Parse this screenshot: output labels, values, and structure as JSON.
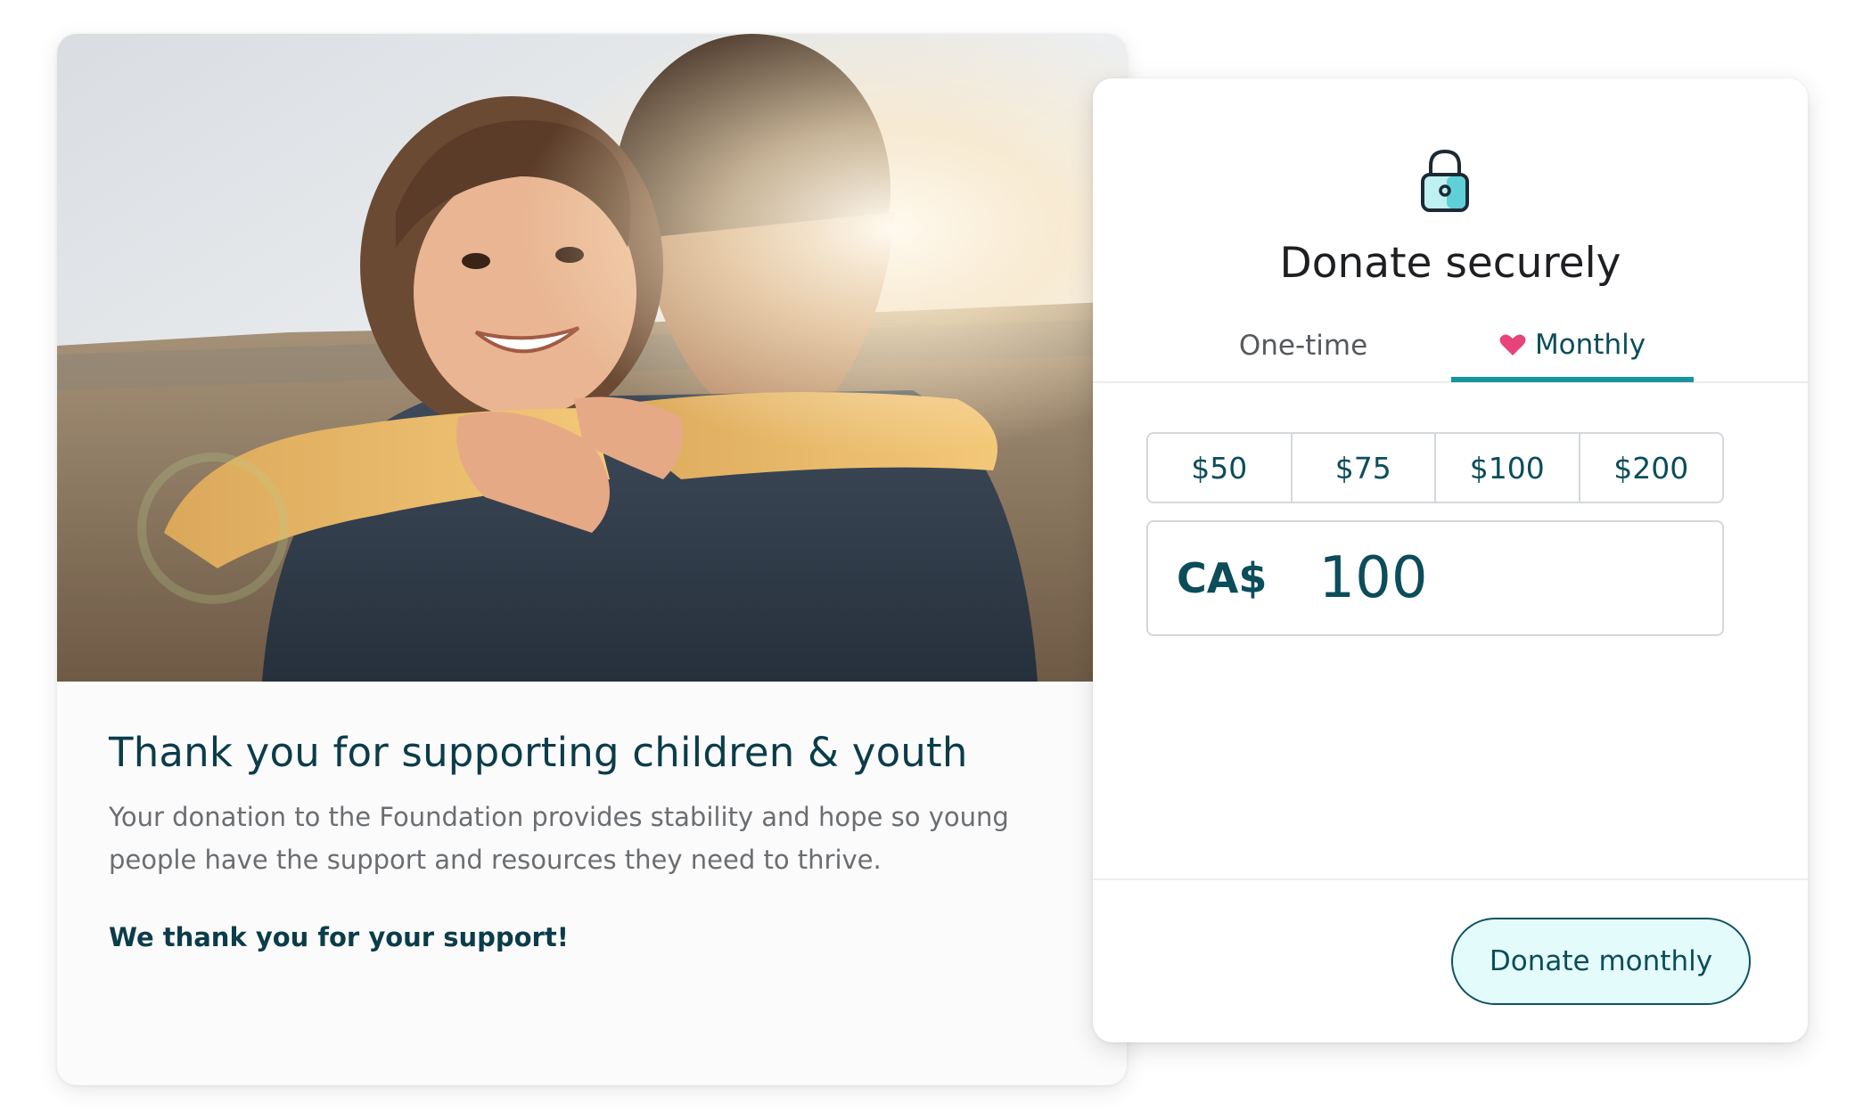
{
  "story": {
    "image_alt": "Child hugging parent in a sunlit field",
    "title": "Thank you for supporting children & youth",
    "body": "Your donation to the Foundation provides stability and hope so young people have the support and resources they need to thrive.",
    "thanks": "We thank you for your support!"
  },
  "donation": {
    "title": "Donate securely",
    "tabs": [
      {
        "label": "One-time",
        "selected": false
      },
      {
        "label": "Monthly",
        "selected": true,
        "icon": "heart-icon"
      }
    ],
    "amounts": [
      "$50",
      "$75",
      "$100",
      "$200"
    ],
    "currency": "CA$",
    "amount_value": "100",
    "donate_button": "Donate monthly",
    "colors": {
      "accent": "#17949e",
      "text_dark": "#0b4d5a",
      "heart": "#e8437a",
      "button_bg": "#e4fbfb"
    }
  }
}
